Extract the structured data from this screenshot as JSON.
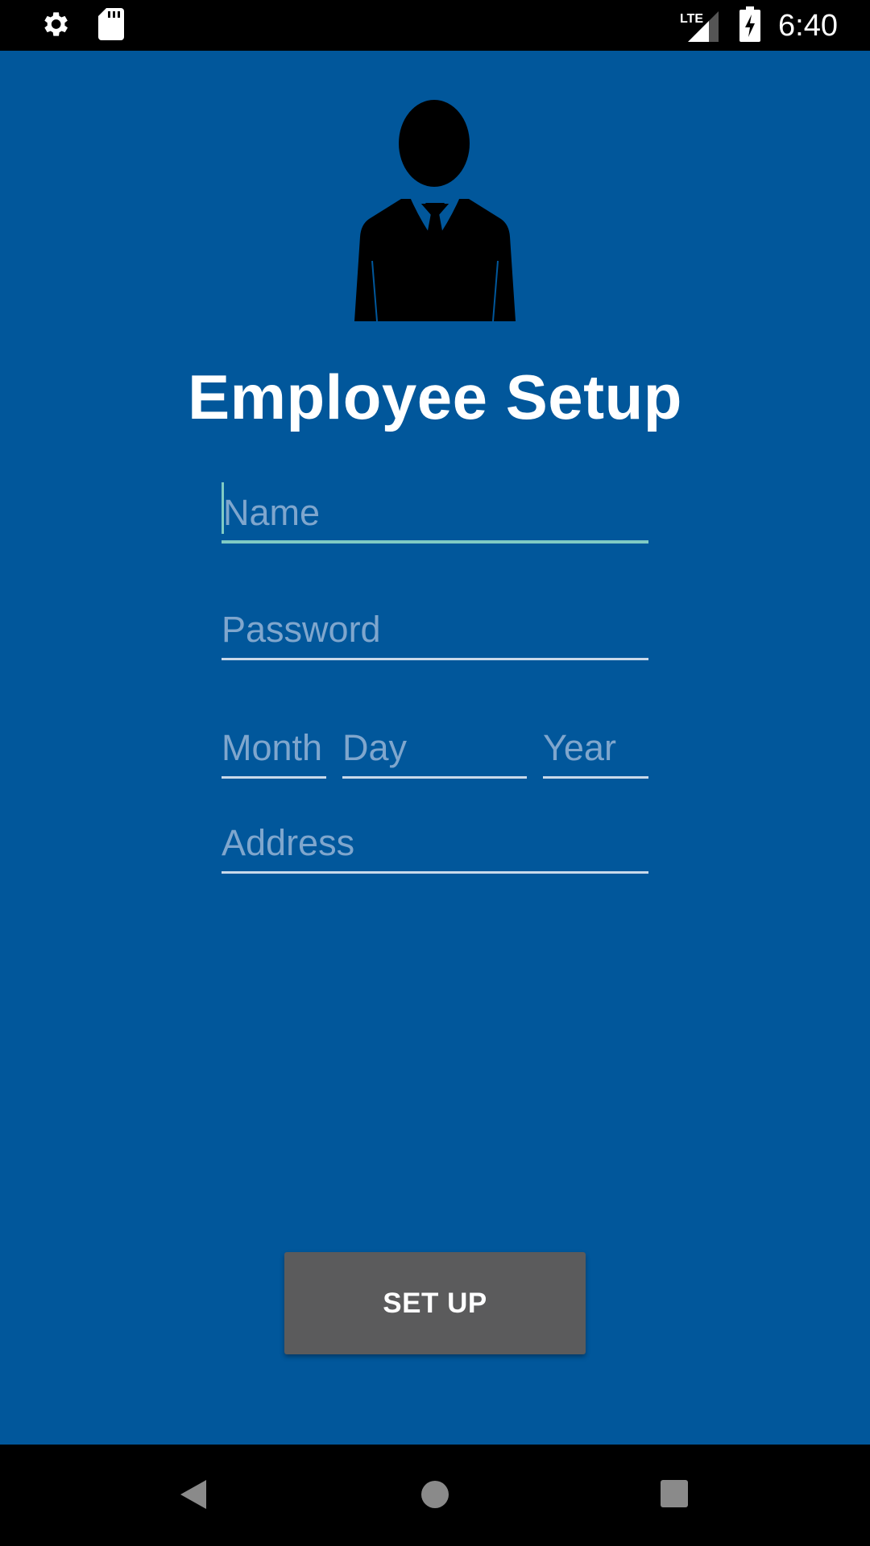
{
  "status_bar": {
    "time": "6:40",
    "network": "LTE",
    "icons": [
      "settings-icon",
      "sd-card-icon",
      "lte-signal-icon",
      "battery-charging-icon"
    ]
  },
  "header": {
    "title": "Employee Setup",
    "avatar_icon": "employee-avatar-icon"
  },
  "form": {
    "name_placeholder": "Name",
    "password_placeholder": "Password",
    "month_placeholder": "Month",
    "day_placeholder": "Day",
    "year_placeholder": "Year",
    "address_placeholder": "Address"
  },
  "actions": {
    "setup_label": "SET UP"
  },
  "nav_bar": {
    "icons": [
      "back-icon",
      "home-icon",
      "recents-icon"
    ]
  },
  "colors": {
    "background": "#01579B",
    "accent": "#80CBC4",
    "button": "#5B5B5C",
    "placeholder": "#7FA6CD"
  }
}
